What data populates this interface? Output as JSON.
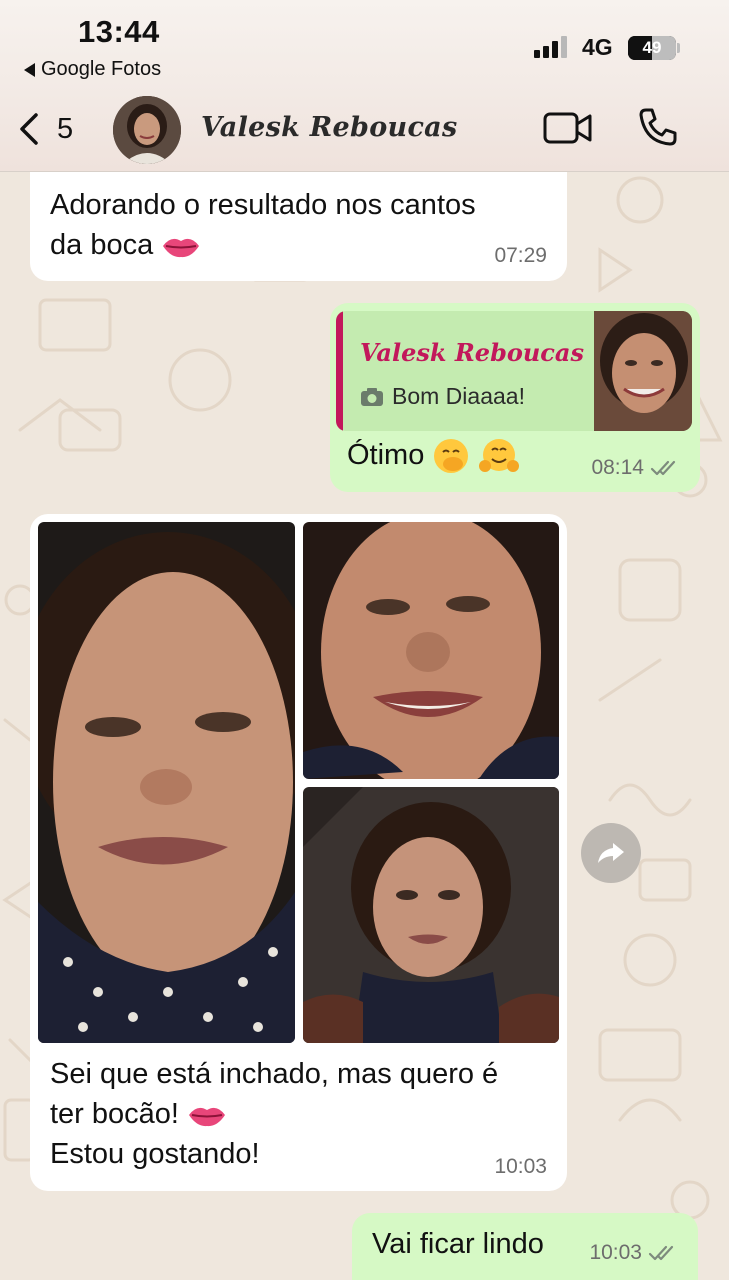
{
  "status_bar": {
    "time": "13:44",
    "back_app": "Google Fotos",
    "network": "4G",
    "battery": "49"
  },
  "header": {
    "unread_count": "5",
    "contact_name": "Valesk Reboucas"
  },
  "messages": [
    {
      "direction": "incoming",
      "text_line1": "Adorando o resultado nos cantos",
      "text_line2": "da boca",
      "emoji": "lips",
      "time": "07:29"
    },
    {
      "direction": "outgoing",
      "quote_author": "Valesk Reboucas",
      "quote_text": "Bom Diaaaa!",
      "text": "Ótimo",
      "emojis": [
        "face-with-hand-over-mouth",
        "hugging-face"
      ],
      "time": "08:14",
      "status": "read"
    },
    {
      "direction": "incoming",
      "photos": 3,
      "text_line1": "Sei que está inchado, mas quero é",
      "text_line2": "ter bocão!",
      "text_line3": "Estou gostando!",
      "emoji": "lips",
      "time": "10:03"
    },
    {
      "direction": "outgoing",
      "text": "Vai ficar lindo",
      "time": "10:03",
      "status": "read"
    }
  ],
  "colors": {
    "incoming_bubble": "#ffffff",
    "outgoing_bubble": "#d6f9c5",
    "quote_accent": "#c2185b",
    "background": "#efe7dd"
  }
}
